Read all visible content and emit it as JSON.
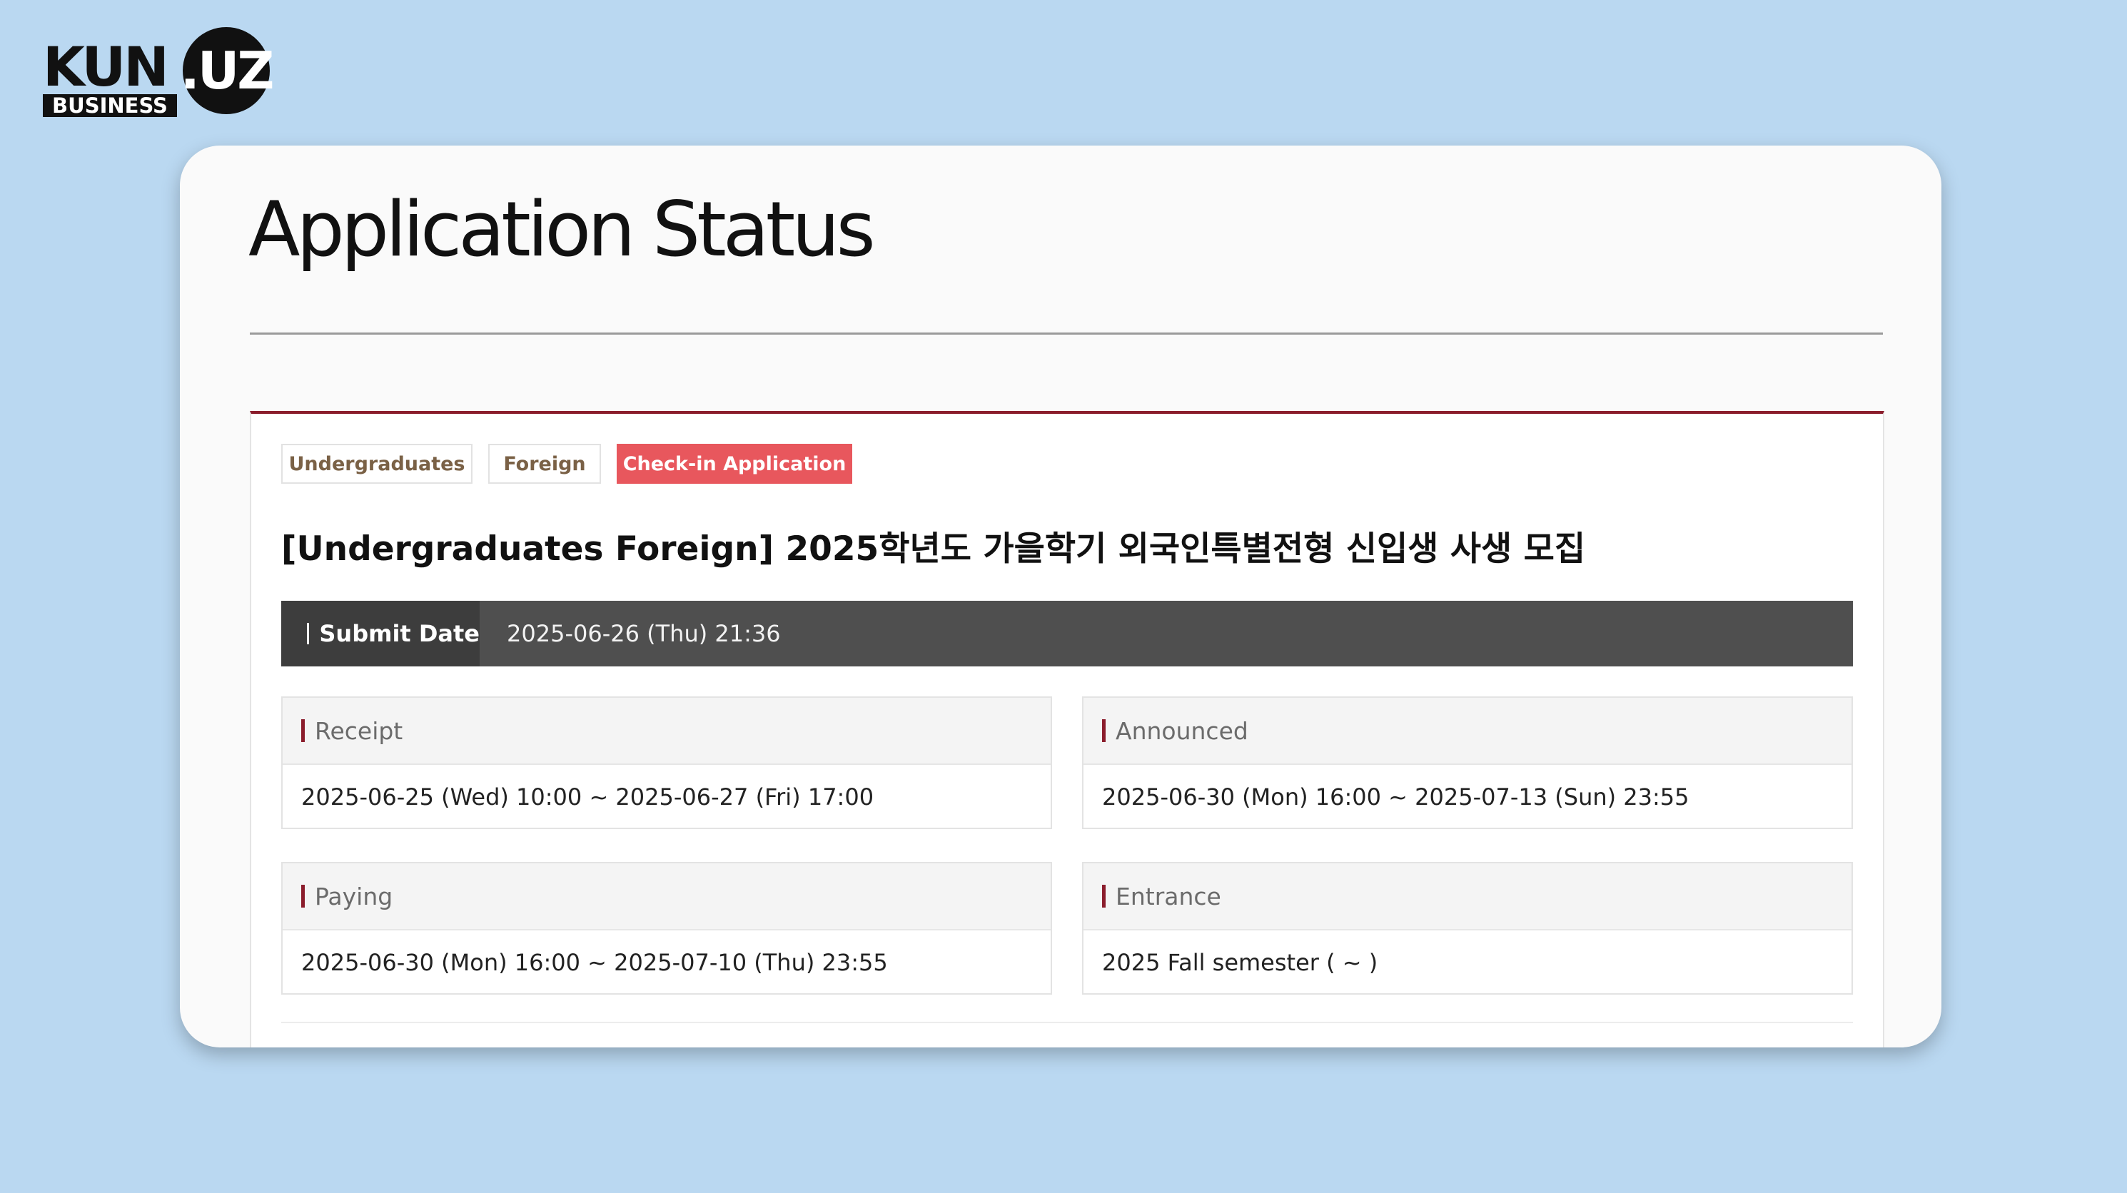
{
  "logo": {
    "kun": "KUN",
    "uz": ".UZ",
    "business": "BUSINESS"
  },
  "page": {
    "title": "Application Status"
  },
  "tabs": [
    {
      "label": "Undergraduates",
      "active": false
    },
    {
      "label": "Foreign",
      "active": false
    },
    {
      "label": "Check-in Application",
      "active": true
    }
  ],
  "application": {
    "title": "[Undergraduates Foreign] 2025학년도 가을학기 외국인특별전형 신입생 사생 모집"
  },
  "submit": {
    "label": "Submit Date",
    "value": "2025-06-26 (Thu) 21:36"
  },
  "info": [
    {
      "label": "Receipt",
      "value": "2025-06-25 (Wed) 10:00 ~ 2025-06-27 (Fri) 17:00"
    },
    {
      "label": "Announced",
      "value": "2025-06-30 (Mon) 16:00 ~ 2025-07-13 (Sun) 23:55"
    },
    {
      "label": "Paying",
      "value": "2025-06-30 (Mon) 16:00 ~ 2025-07-10 (Thu) 23:55"
    },
    {
      "label": "Entrance",
      "value": "2025 Fall semester ( ~ )"
    }
  ],
  "colors": {
    "background": "#bad8f1",
    "accent": "#8b1d2c",
    "active_tab": "#e8575d",
    "submit_bar": "#4f4f4f"
  }
}
